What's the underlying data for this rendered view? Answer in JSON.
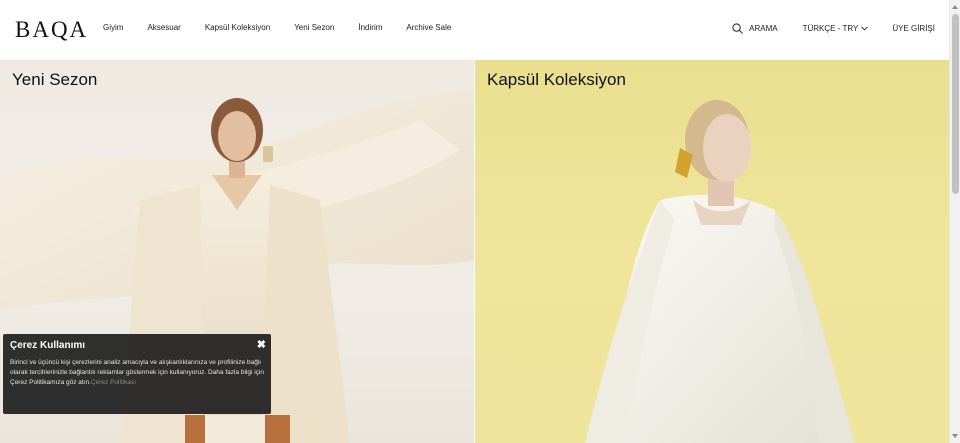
{
  "header": {
    "logo": "BAQA",
    "nav": [
      {
        "label": "Giyim"
      },
      {
        "label": "Aksesuar"
      },
      {
        "label": "Kapsül Koleksiyon"
      },
      {
        "label": "Yeni Sezon"
      },
      {
        "label": "İndirim"
      },
      {
        "label": "Archive Sale"
      }
    ],
    "search_label": "ARAMA",
    "language_label": "TÜRKÇE - TRY",
    "login_label": "ÜYE GİRİŞİ"
  },
  "panels": {
    "left_title": "Yeni Sezon",
    "right_title": "Kapsül Koleksiyon"
  },
  "cookie": {
    "title": "Çerez Kullanımı",
    "body": "Birinci ve üçüncü kişi çerezlerini analiz amacıyla ve alışkanlıklarınıza ve profilinize bağlı olarak tercihlerinizle bağlantılı reklamlar göstermek için kullanıyoruz. Daha fazla bilgi için Çerez Politikamıza göz atın.",
    "link": "Çerez Politikası",
    "close_symbol": "✖"
  },
  "colors": {
    "left_bg": "#efe9e2",
    "right_bg": "#eee39a",
    "cookie_bg": "#1e1e1e"
  }
}
